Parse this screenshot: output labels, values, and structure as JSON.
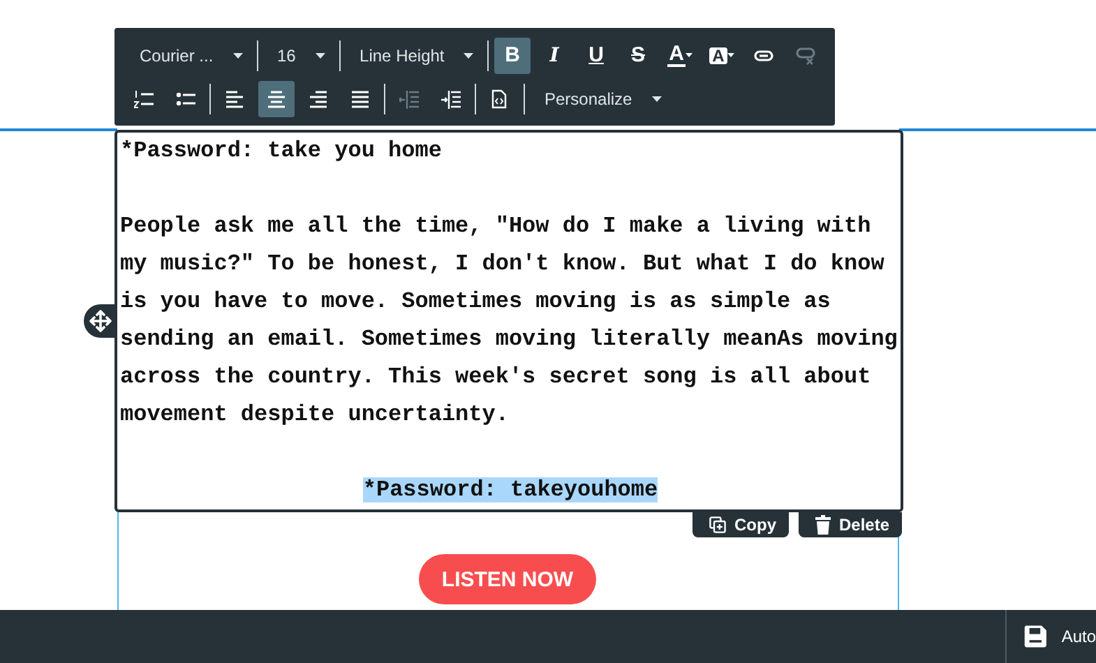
{
  "toolbar": {
    "rows": [
      [
        [
          {
            "kind": "dropdown",
            "label": "Courier ..."
          }
        ],
        [
          {
            "kind": "dropdown",
            "label": "16"
          }
        ],
        [
          {
            "kind": "dropdown",
            "label": "Line Height"
          }
        ],
        [
          {
            "kind": "bold",
            "label": "B",
            "selected": true,
            "disabled": false
          },
          {
            "kind": "italic",
            "label": "I",
            "selected": false,
            "disabled": false
          },
          {
            "kind": "underline",
            "label": "U",
            "selected": false,
            "disabled": false
          },
          {
            "kind": "strike",
            "label": "S",
            "selected": false,
            "disabled": false
          },
          {
            "kind": "font-color",
            "label": "A",
            "selected": false,
            "disabled": false
          },
          {
            "kind": "highlight-color",
            "label": "A",
            "selected": false,
            "disabled": false
          },
          {
            "kind": "link",
            "selected": false,
            "disabled": false
          },
          {
            "kind": "unlink",
            "selected": false,
            "disabled": true
          }
        ]
      ],
      [
        [
          {
            "kind": "ordered-list",
            "selected": false,
            "disabled": false
          },
          {
            "kind": "bullet-list",
            "selected": false,
            "disabled": false
          }
        ],
        [
          {
            "kind": "align-left",
            "selected": false,
            "disabled": false
          },
          {
            "kind": "align-center",
            "selected": true,
            "disabled": false
          },
          {
            "kind": "align-right",
            "selected": false,
            "disabled": false
          },
          {
            "kind": "justify",
            "selected": false,
            "disabled": false
          }
        ],
        [
          {
            "kind": "outdent",
            "selected": false,
            "disabled": true
          },
          {
            "kind": "indent",
            "selected": false,
            "disabled": false
          }
        ],
        [
          {
            "kind": "source",
            "selected": false,
            "disabled": false
          }
        ],
        [
          {
            "kind": "dropdown",
            "label": "Personalize"
          }
        ]
      ]
    ]
  },
  "editor": {
    "paragraphs": [
      {
        "text": "*Password: take you home",
        "kind": "body",
        "highlighted": false
      },
      {
        "text": "People ask me all the time, \"How do I make a living with my music?\" To be honest, I don't know. But what I do know is you have to move. Sometimes moving is as simple as sending an email. Sometimes moving literally meanAs moving across the country. This week's secret song is all about movement despite uncertainty.",
        "kind": "body",
        "highlighted": false
      },
      {
        "text": "*Password: takeyouhome",
        "kind": "centered",
        "highlighted": true
      }
    ],
    "actions": [
      {
        "kind": "copy",
        "label": "Copy"
      },
      {
        "kind": "delete",
        "label": "Delete"
      }
    ]
  },
  "cta_button": {
    "label": "LISTEN NOW"
  },
  "status_bar": {
    "save_label": "Auto"
  }
}
